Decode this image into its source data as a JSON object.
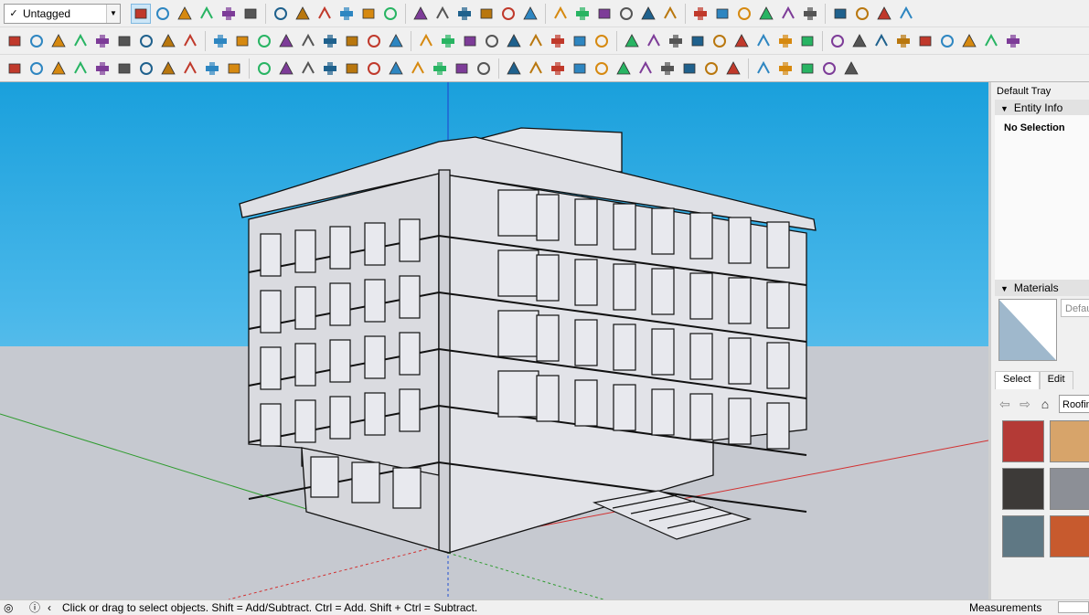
{
  "toolbar": {
    "tag_select_value": "Untagged",
    "row1_icons": [
      "select-arrow-icon",
      "eraser-icon",
      "pencil-line-icon",
      "arc-icon",
      "shape-icon",
      "push-pull-icon",
      "follow-me-icon",
      "move-icon",
      "rotate-icon",
      "scale-icon",
      "tape-measure-icon",
      "text-icon",
      "paint-bucket-icon",
      "orbit-icon",
      "pan-icon",
      "zoom-icon",
      "zoom-extents-icon",
      "warehouse-icon",
      "extension-icon",
      "layers-icon",
      "add-location-icon",
      "account-icon",
      "iso-view-icon",
      "top-view-icon",
      "front-view-icon",
      "right-view-icon",
      "back-view-icon",
      "left-view-icon",
      "xray-icon",
      "wireframe-icon",
      "shaded-icon",
      "textured-icon",
      "section-plane-icon",
      "section-display-icon"
    ],
    "row2_icons": [
      "sandbox-icon",
      "smoove-icon",
      "stamp-icon",
      "drape-icon",
      "add-detail-icon",
      "flip-edge-icon",
      "tag-icon",
      "paint-sample-icon",
      "box-icon",
      "grid-icon",
      "flag-icon",
      "door-icon",
      "handrail-icon",
      "stair-icon",
      "curve-icon",
      "cross-icon",
      "plus-icon",
      "rotate-x-icon",
      "cone-icon",
      "pyramid-icon",
      "warning-icon",
      "refresh-icon",
      "loop-icon",
      "spiral-icon",
      "compass-icon",
      "pot-icon",
      "undo-icon",
      "puzzle-icon",
      "copy-icon",
      "mirror-icon",
      "sync-icon",
      "target-icon",
      "flower-icon",
      "frame-icon",
      "tile-icon",
      "tile2-icon",
      "tile3-icon",
      "scatter-icon",
      "circle-icon",
      "array-icon",
      "block-icon",
      "book-icon",
      "fill-icon",
      "fill2-icon",
      "fill3-icon"
    ],
    "row3_icons": [
      "lumion-icon",
      "refresh-sync-icon",
      "film-icon",
      "add-icon",
      "tree-icon",
      "ramp-icon",
      "checker-icon",
      "cloud-upload-icon",
      "settings-gear-icon",
      "mail-icon",
      "info-icon",
      "trim-icon",
      "extend-icon",
      "fillet-icon",
      "chamfer-icon",
      "offset-icon",
      "project-icon",
      "solid-icon",
      "shell-icon",
      "split-icon",
      "corner-icon",
      "slope-icon",
      "weld-icon",
      "curve-edge-icon",
      "bridge-icon",
      "angle-icon",
      "profile-icon",
      "column-icon",
      "joint-icon",
      "wedge-icon",
      "stack-icon",
      "tangent-icon",
      "connector-icon",
      "stairs-icon",
      "wall-icon",
      "hatch-icon",
      "grid-lines-icon",
      "pattern-icon"
    ]
  },
  "colors": {
    "sky_top": "#1aa0dc",
    "sky_bottom": "#9fd3ee",
    "ground": "#c6c9d0",
    "axis_red": "#d23030",
    "axis_green": "#2e9b2e",
    "axis_blue": "#2050d0",
    "building_face": "#dfe0e5",
    "building_shade": "#c9cad1"
  },
  "tray": {
    "title": "Default Tray",
    "entity_info": {
      "header": "Entity Info",
      "selection": "No Selection"
    },
    "materials": {
      "header": "Materials",
      "current_name": "Default",
      "tab_select": "Select",
      "tab_edit": "Edit",
      "library": "Roofing",
      "swatches": [
        {
          "name": "roofing-red-metal",
          "color": "#b43a36"
        },
        {
          "name": "roofing-shingle-tan",
          "color": "#d7a46a"
        },
        {
          "name": "roofing-slate-dark",
          "color": "#3d3a38"
        },
        {
          "name": "roofing-slate-gray",
          "color": "#8c8f96"
        },
        {
          "name": "roofing-metal-blue",
          "color": "#5f7884"
        },
        {
          "name": "roofing-clay-orange",
          "color": "#c75a2e"
        }
      ]
    }
  },
  "status": {
    "message": "Click or drag to select objects. Shift = Add/Subtract. Ctrl = Add. Shift + Ctrl = Subtract.",
    "measurements_label": "Measurements"
  }
}
